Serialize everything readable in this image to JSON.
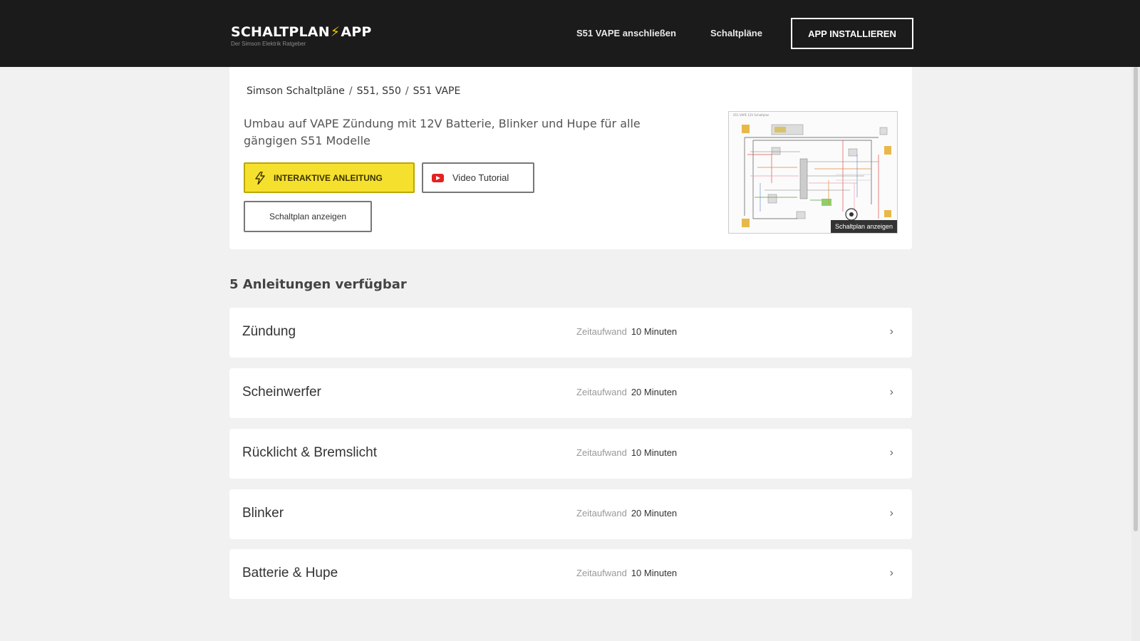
{
  "header": {
    "logo_text_left": "SCHALTPLAN",
    "logo_bolt": "⚡",
    "logo_text_right": "APP",
    "logo_tagline": "Der Simson Elektrik Ratgeber",
    "nav": [
      "S51 VAPE anschließen",
      "Schaltpläne"
    ],
    "install_label": "APP INSTALLIEREN"
  },
  "card": {
    "breadcrumb": [
      "Simson Schaltpläne",
      "S51, S50",
      "S51 VAPE"
    ],
    "breadcrumb_sep": "/",
    "description": "Umbau auf VAPE Zündung mit 12V Batterie, Blinker und Hupe für alle gängigen S51 Modelle",
    "btn_interactive": "INTERAKTIVE ANLEITUNG",
    "btn_video": "Video Tutorial",
    "btn_schematic": "Schaltplan anzeigen",
    "thumbnail_caption": "Schaltplan anzeigen"
  },
  "guides": {
    "count_label": "5 Anleitungen verfügbar",
    "time_label": "Zeitaufwand",
    "items": [
      {
        "title": "Zündung",
        "time": "10 Minuten"
      },
      {
        "title": "Scheinwerfer",
        "time": "20 Minuten"
      },
      {
        "title": "Rücklicht & Bremslicht",
        "time": "10 Minuten"
      },
      {
        "title": "Blinker",
        "time": "20 Minuten"
      },
      {
        "title": "Batterie & Hupe",
        "time": "10 Minuten"
      }
    ]
  },
  "colors": {
    "header_bg": "#1b1b1b",
    "accent_yellow": "#f6e02e",
    "youtube_red": "#e32222",
    "page_bg": "#f1f1f1"
  },
  "icons": {
    "bolt": "lightning-bolt-icon",
    "video": "youtube-play-icon",
    "chevron": "chevron-right-icon"
  }
}
